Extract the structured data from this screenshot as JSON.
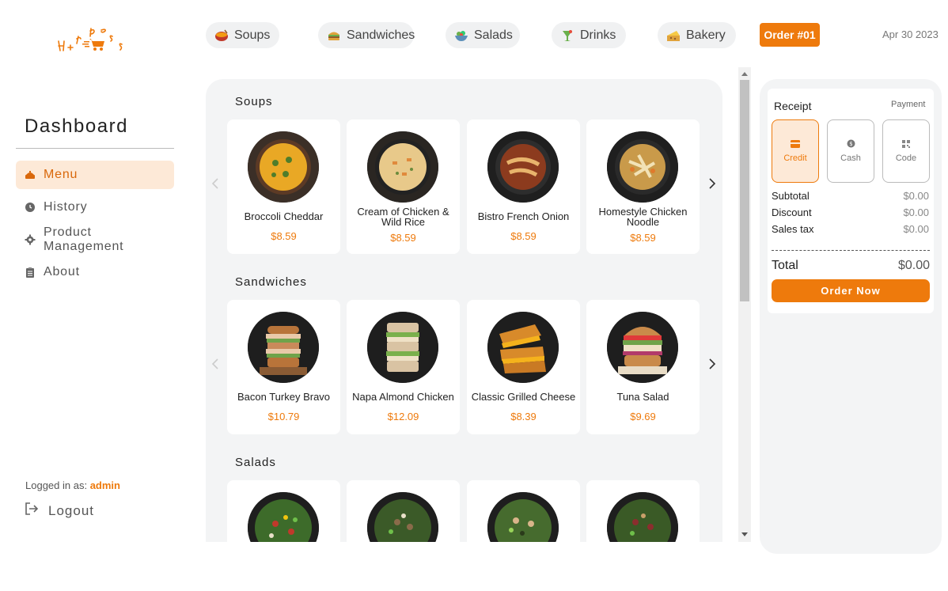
{
  "brand": {
    "logo_text": "ExpresS"
  },
  "categories": [
    {
      "label": "Soups",
      "icon": "soup-bowl-icon"
    },
    {
      "label": "Sandwiches",
      "icon": "sandwich-icon"
    },
    {
      "label": "Salads",
      "icon": "salad-icon"
    },
    {
      "label": "Drinks",
      "icon": "drink-icon"
    },
    {
      "label": "Bakery",
      "icon": "bakery-icon"
    }
  ],
  "order_badge": "Order #01",
  "date": "Apr 30 2023",
  "sidebar": {
    "title": "Dashboard",
    "items": [
      {
        "label": "Menu",
        "icon": "menu-icon",
        "active": true
      },
      {
        "label": "History",
        "icon": "history-icon"
      },
      {
        "label": "Product Management",
        "icon": "gear-icon"
      },
      {
        "label": "About",
        "icon": "clipboard-icon"
      }
    ],
    "logged_in_prefix": "Logged in as:",
    "logged_in_user": "admin",
    "logout_label": "Logout"
  },
  "sections": [
    {
      "title": "Soups",
      "items": [
        {
          "name": "Broccoli Cheddar",
          "price": "$8.59"
        },
        {
          "name": "Cream of Chicken & Wild Rice",
          "price": "$8.59"
        },
        {
          "name": "Bistro French Onion",
          "price": "$8.59"
        },
        {
          "name": "Homestyle Chicken Noodle",
          "price": "$8.59"
        }
      ]
    },
    {
      "title": "Sandwiches",
      "items": [
        {
          "name": "Bacon Turkey Bravo",
          "price": "$10.79"
        },
        {
          "name": "Napa Almond Chicken",
          "price": "$12.09"
        },
        {
          "name": "Classic Grilled Cheese",
          "price": "$8.39"
        },
        {
          "name": "Tuna Salad",
          "price": "$9.69"
        }
      ]
    },
    {
      "title": "Salads",
      "items": [
        {
          "name": "",
          "price": ""
        },
        {
          "name": "",
          "price": ""
        },
        {
          "name": "",
          "price": ""
        },
        {
          "name": "",
          "price": ""
        }
      ]
    }
  ],
  "receipt": {
    "title": "Receipt",
    "payment_label": "Payment",
    "payment_methods": [
      {
        "label": "Credit",
        "icon": "credit-card-icon",
        "active": true
      },
      {
        "label": "Cash",
        "icon": "coin-icon"
      },
      {
        "label": "Code",
        "icon": "qr-code-icon"
      }
    ],
    "rows": [
      {
        "label": "Subtotal",
        "value": "$0.00"
      },
      {
        "label": "Discount",
        "value": "$0.00"
      },
      {
        "label": "Sales tax",
        "value": "$0.00"
      }
    ],
    "total_label": "Total",
    "total_value": "$0.00",
    "order_button": "Order Now"
  },
  "colors": {
    "accent": "#ee7a0c",
    "accent_light": "#fde9d7",
    "panel_bg": "#f3f4f5",
    "pill_bg": "#f0f1f2"
  }
}
